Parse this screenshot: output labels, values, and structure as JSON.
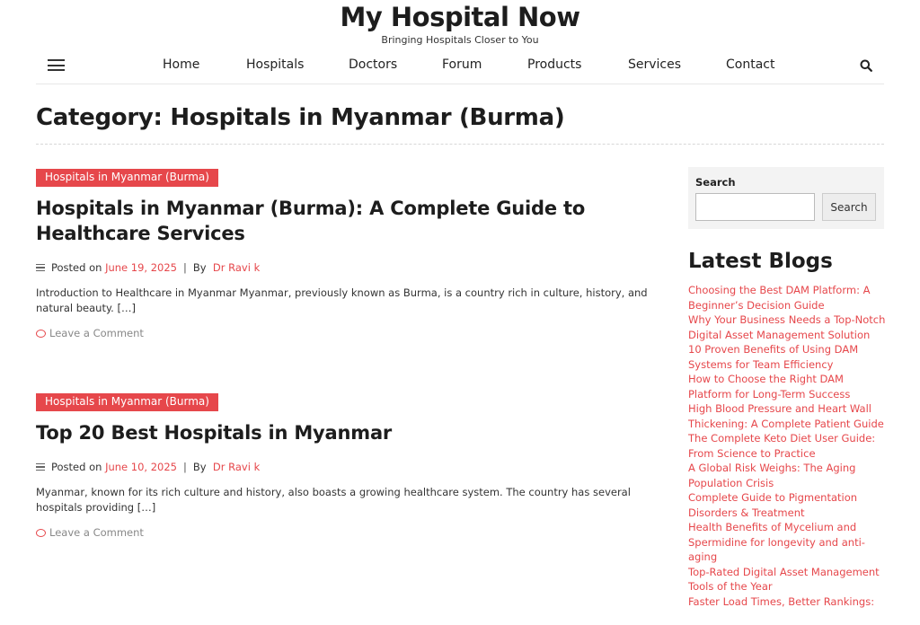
{
  "site": {
    "title": "My Hospital Now",
    "tagline": "Bringing Hospitals Closer to You"
  },
  "nav": {
    "items": [
      "Home",
      "Hospitals",
      "Doctors",
      "Forum",
      "Products",
      "Services",
      "Contact"
    ]
  },
  "page": {
    "title": "Category: Hospitals in Myanmar (Burma)"
  },
  "posts": [
    {
      "category": "Hospitals in Myanmar (Burma)",
      "title": "Hospitals in Myanmar (Burma): A Complete Guide to Healthcare Services",
      "posted_on": "Posted on",
      "date": "June 19, 2025",
      "separator": "|",
      "by": "By",
      "author": "Dr Ravi k",
      "excerpt": "Introduction to Healthcare in Myanmar Myanmar, previously known as Burma, is a country rich in culture, history, and natural beauty. […]",
      "comment": "Leave a Comment"
    },
    {
      "category": "Hospitals in Myanmar (Burma)",
      "title": "Top 20 Best Hospitals in Myanmar",
      "posted_on": "Posted on",
      "date": "June 10, 2025",
      "separator": "|",
      "by": "By",
      "author": "Dr Ravi k",
      "excerpt": "Myanmar, known for its rich culture and history, also boasts a growing healthcare system. The country has several hospitals providing […]",
      "comment": "Leave a Comment"
    }
  ],
  "sidebar": {
    "search_label": "Search",
    "search_placeholder": "",
    "search_button": "Search",
    "latest_title": "Latest Blogs",
    "latest_blogs": [
      "Choosing the Best DAM Platform: A Beginner’s Decision Guide",
      "Why Your Business Needs a Top-Notch Digital Asset Management Solution",
      "10 Proven Benefits of Using DAM Systems for Team Efficiency",
      "How to Choose the Right DAM Platform for Long-Term Success",
      "High Blood Pressure and Heart Wall Thickening: A Complete Patient Guide",
      "The Complete Keto Diet User Guide: From Science to Practice",
      "A Global Risk Weighs: The Aging Population Crisis",
      "Complete Guide to Pigmentation Disorders & Treatment",
      "Health Benefits of Mycelium and Spermidine for longevity and anti-aging",
      "Top-Rated Digital Asset Management Tools of the Year",
      "Faster Load Times, Better Rankings:"
    ]
  },
  "icons": {
    "menu": "hamburger-icon",
    "search": "search-icon",
    "meta": "list-icon",
    "comment": "comment-icon"
  },
  "colors": {
    "accent": "#e6474b",
    "text": "#1d1d1d",
    "muted": "#888888",
    "sidebar_bg": "#f3f3f3"
  }
}
